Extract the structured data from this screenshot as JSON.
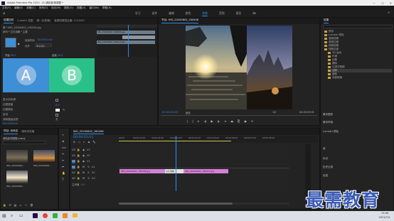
{
  "titlebar": {
    "title": "Adobe Premiere Pro 2020 - D:\\调色影调调整 *",
    "menu": [
      "文件(F)",
      "编辑(E)",
      "剪辑(C)",
      "序列(S)",
      "标记(M)",
      "图形(G)",
      "视图(V)",
      "窗口(W)",
      "帮助(H)"
    ]
  },
  "workspaces": [
    "学习",
    "组件",
    "编辑",
    "颜色",
    "效果",
    "音频",
    "图形",
    "库"
  ],
  "active_workspace": "效果",
  "effect_controls": {
    "tabs": [
      "效果控件",
      "Lumetri 范围",
      "源: (无剪辑)",
      "音频剪辑混合器: 0-20200"
    ],
    "source_label": "源 * IMG_20200602_195245.jpg",
    "clip_label": "序列 * 交叉溶解 * 主要",
    "mini_clips": [
      "IMG_20200602_180408.jpg",
      "IMG_20200602_180413.jpg"
    ],
    "duration_label": "持续时间",
    "duration_value": "00:00:01:00",
    "alignment_label": "对齐",
    "alignment_value": "中心切入",
    "a_label": "A",
    "b_label": "B",
    "start_label": "开始",
    "start_value": "50.0",
    "end_label": "结束",
    "end_value": "50.0",
    "show_actual": "显示实际源",
    "border_width": "边框宽度",
    "border_color": "边框颜色",
    "reverse": "反向",
    "antialias": "消除锯齿品质",
    "antialias_value": "关",
    "timecode": "00:00:03:03"
  },
  "program_monitor": {
    "title": "节目: IMG_20200602_180408",
    "timecode": "00:00:03:03",
    "fit": "适合",
    "quality": "1/2",
    "end_timecode": "00:00:05:05"
  },
  "effects_panel": {
    "title": "效果",
    "items": [
      "预设",
      "Lumetri 预设",
      "音频效果",
      "音频过渡",
      "视频效果",
      "视频过渡",
      "3D 运动",
      "内滑",
      "划像",
      "擦除",
      "沉浸式视频",
      "溶解",
      "缩放",
      "页面剥落"
    ],
    "extra": [
      "基本图形",
      "基本声音",
      "Lumetri 颜色",
      "库",
      "标记",
      "历史记录",
      "信息"
    ]
  },
  "project_panel": {
    "tabs": [
      "项目: 未命名",
      "媒体浏览器"
    ],
    "file_label": "调色影调调整.prproj",
    "items": [
      "IMG_20200602...",
      "IMG_20200602...",
      "IMG_20200602..."
    ]
  },
  "timeline": {
    "tab": "IMG_20200602_180408",
    "timecode": "00:00:03:03",
    "ruler": [
      "00:00",
      "00:00:01:00",
      "00:00:02:00",
      "00:00:03:00",
      "00:00:04:00",
      "00:00:05:00",
      "00:00:06:00",
      "00:00:07:00",
      "00:00:08:00"
    ],
    "tracks": [
      "V3",
      "V2",
      "V1",
      "A1",
      "A2",
      "A3"
    ],
    "master": "主声道",
    "master_value": "0.0",
    "clips": [
      "IMG_20200602_180408.jpg",
      "交叉溶解",
      "IMG_20200602_180413.jpg"
    ]
  },
  "taskbar": {
    "time": "15:46",
    "date": "2021/7/4"
  },
  "watermark": "最需教育",
  "colors": {
    "accent": "#2d8ceb",
    "clip": "#d580d6",
    "block_a": "#3f8fd6",
    "block_b": "#29c189"
  }
}
